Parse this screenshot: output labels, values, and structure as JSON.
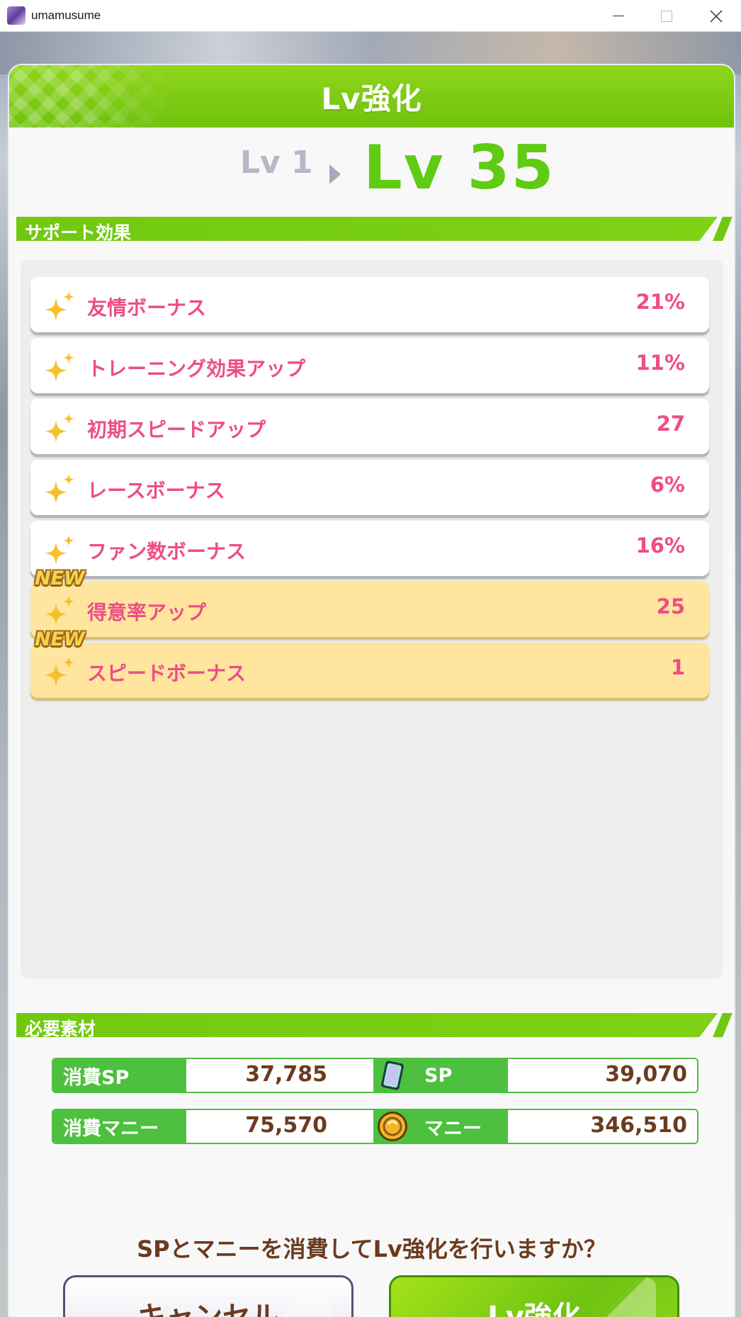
{
  "window": {
    "title": "umamusume",
    "controls": [
      "minimize",
      "maximize",
      "close"
    ]
  },
  "dialog": {
    "title": "Lv強化",
    "level_from": "Lv 1",
    "level_to": "Lv 35",
    "support_section_label": "サポート効果",
    "materials_section_label": "必要素材"
  },
  "effects": [
    {
      "name": "友情ボーナス",
      "value": "21%",
      "is_new": false
    },
    {
      "name": "トレーニング効果アップ",
      "value": "11%",
      "is_new": false
    },
    {
      "name": "初期スピードアップ",
      "value": "27",
      "is_new": false
    },
    {
      "name": "レースボーナス",
      "value": "6%",
      "is_new": false
    },
    {
      "name": "ファン数ボーナス",
      "value": "16%",
      "is_new": false
    },
    {
      "name": "得意率アップ",
      "value": "25",
      "is_new": true,
      "badge": "NEW"
    },
    {
      "name": "スピードボーナス",
      "value": "1",
      "is_new": true,
      "badge": "NEW"
    }
  ],
  "materials": {
    "sp_cost_label": "消費SP",
    "sp_cost_value": "37,785",
    "sp_owned_label": "SP",
    "sp_owned_value": "39,070",
    "money_cost_label": "消費マニー",
    "money_cost_value": "75,570",
    "money_owned_label": "マニー",
    "money_owned_value": "346,510"
  },
  "confirm_text": "SPとマニーを消費してLv強化を行いますか？",
  "buttons": {
    "cancel": "キャンセル",
    "confirm": "Lv強化"
  },
  "colors": {
    "accent_green": "#71c90f",
    "level_green": "#5fcb12",
    "effect_pink": "#ee4d86",
    "new_row_bg": "#ffe59e",
    "text_brown": "#6b3b1f"
  },
  "icons": {
    "effect": "sparkle-icon",
    "sp": "sp-card-icon",
    "money": "coin-icon"
  }
}
